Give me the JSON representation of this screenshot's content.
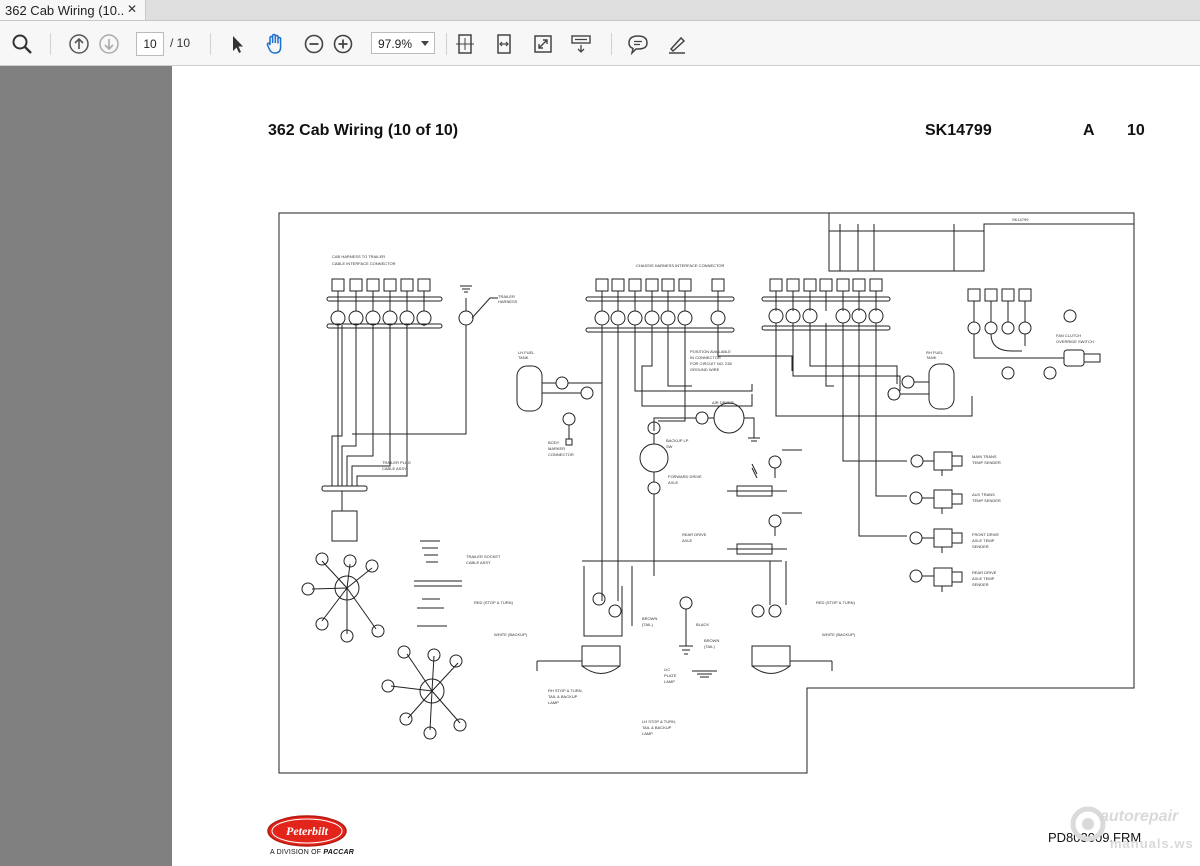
{
  "tab": {
    "title": "362 Cab Wiring (10...",
    "close": "✕"
  },
  "toolbar": {
    "page_current": "10",
    "page_total": "/ 10",
    "zoom": "97.9%",
    "icons": [
      "search-icon",
      "page-up-icon",
      "page-down-icon",
      "select-arrow-icon",
      "hand-icon",
      "zoom-out-icon",
      "zoom-in-icon",
      "fit-page-icon",
      "fit-width-icon",
      "full-screen-icon",
      "read-mode-icon",
      "comment-icon",
      "highlight-icon"
    ]
  },
  "document": {
    "title": "362 Cab Wiring (10 of 10)",
    "sk_number": "SK14799",
    "revision": "A",
    "sheet": "10",
    "footer_file": "PD803009.FRM",
    "logo_text": "Peterbilt",
    "logo_sub": "A DIVISION OF",
    "logo_sub_brand": "PACCAR"
  },
  "watermark": {
    "line1": "autorepair",
    "line2": "manuals.ws"
  },
  "colors": {
    "logo_red": "#e3241b",
    "chrome_bg": "#f7f7f7",
    "viewer_bg": "#808080"
  }
}
